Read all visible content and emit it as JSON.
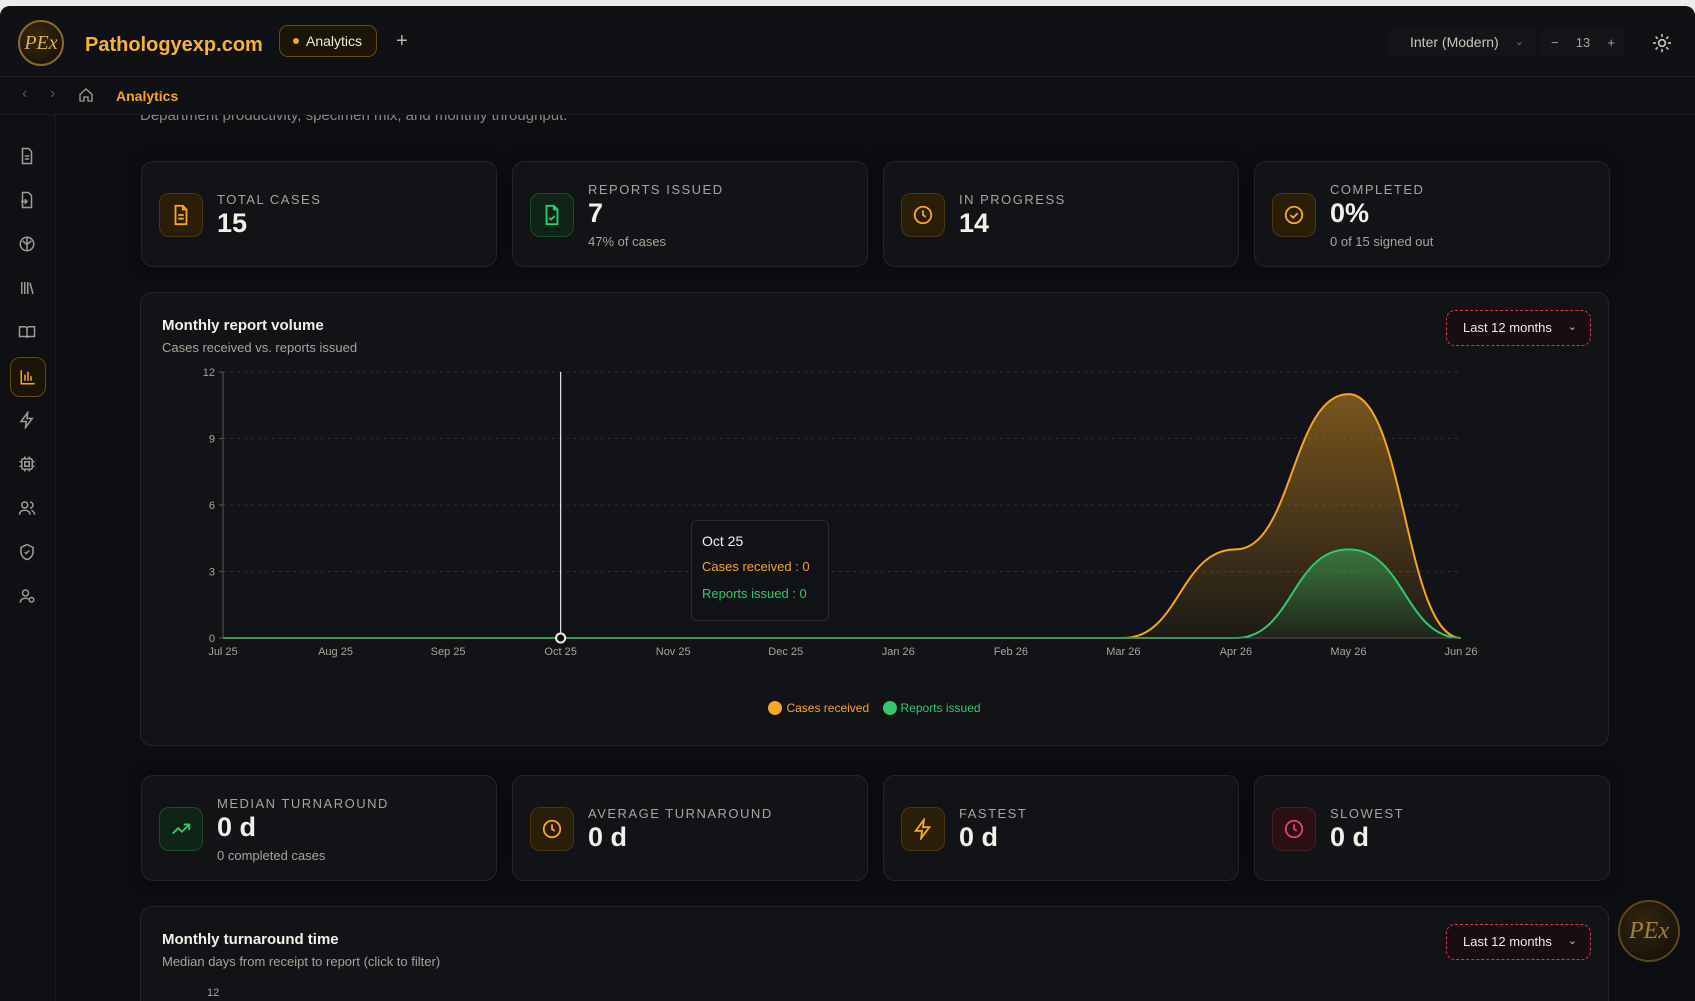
{
  "app": {
    "brand": "Pathologyexp.com",
    "logo_text": "PEx",
    "tab_label": "Analytics",
    "font_select": "Inter (Modern)",
    "font_size": "13"
  },
  "breadcrumb": {
    "current": "Analytics"
  },
  "page": {
    "description": "Department productivity, specimen mix, and monthly throughput."
  },
  "stats_top": [
    {
      "label": "TOTAL CASES",
      "value": "15",
      "sub": "",
      "icon": "document-icon",
      "tone": "amber"
    },
    {
      "label": "REPORTS ISSUED",
      "value": "7",
      "sub": "47% of cases",
      "icon": "file-check-icon",
      "tone": "green"
    },
    {
      "label": "IN PROGRESS",
      "value": "14",
      "sub": "",
      "icon": "clock-icon",
      "tone": "amber"
    },
    {
      "label": "COMPLETED",
      "value": "0%",
      "sub": "0 of 15 signed out",
      "icon": "check-circle-icon",
      "tone": "amber"
    }
  ],
  "volume_panel": {
    "title": "Monthly report volume",
    "subtitle": "Cases received vs. reports issued",
    "range": "Last 12 months",
    "tooltip": {
      "date": "Oct 25",
      "cases_text": "Cases received : 0",
      "reports_text": "Reports issued : 0"
    },
    "legend": [
      "Cases received",
      "Reports issued"
    ]
  },
  "chart_data": {
    "type": "area",
    "categories": [
      "Jul 25",
      "Aug 25",
      "Sep 25",
      "Oct 25",
      "Nov 25",
      "Dec 25",
      "Jan 26",
      "Feb 26",
      "Mar 26",
      "Apr 26",
      "May 26",
      "Jun 26"
    ],
    "series": [
      {
        "name": "Cases received",
        "values": [
          0,
          0,
          0,
          0,
          0,
          0,
          0,
          0,
          0,
          4,
          11,
          0
        ],
        "color": "#f5a623"
      },
      {
        "name": "Reports issued",
        "values": [
          0,
          0,
          0,
          0,
          0,
          0,
          0,
          0,
          0,
          0,
          4,
          0
        ],
        "color": "#2fca6a"
      }
    ],
    "yticks": [
      0,
      3,
      6,
      9,
      12
    ],
    "ylim": [
      0,
      12
    ],
    "grid": true,
    "legend_position": "bottom",
    "highlight_category": "Oct 25"
  },
  "stats_bottom": [
    {
      "label": "MEDIAN TURNAROUND",
      "value": "0 d",
      "sub": "0 completed cases",
      "icon": "trending-up-icon",
      "tone": "green"
    },
    {
      "label": "AVERAGE TURNAROUND",
      "value": "0 d",
      "sub": "",
      "icon": "clock-icon",
      "tone": "amber"
    },
    {
      "label": "FASTEST",
      "value": "0 d",
      "sub": "",
      "icon": "lightning-icon",
      "tone": "amber"
    },
    {
      "label": "SLOWEST",
      "value": "0 d",
      "sub": "",
      "icon": "clock-icon",
      "tone": "red"
    }
  ],
  "turnaround_panel": {
    "title": "Monthly turnaround time",
    "subtitle": "Median days from receipt to report (click to filter)",
    "range": "Last 12 months",
    "first_tick": "12"
  },
  "colors": {
    "accent": "#f5a623",
    "green": "#2fca6a",
    "red": "#e0455f",
    "bg": "#0d0e11"
  }
}
